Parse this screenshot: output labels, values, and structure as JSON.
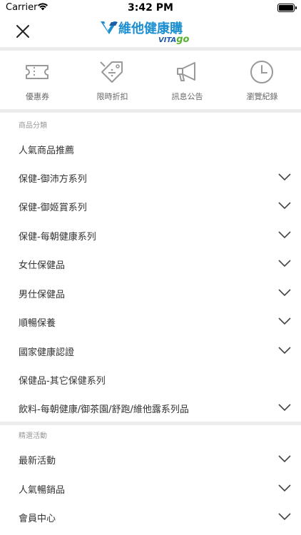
{
  "status_bar": {
    "carrier": "Carrier",
    "time": "3:42 PM"
  },
  "header": {
    "logo_text": "維他健康購",
    "logo_sub_left": "VITA",
    "logo_sub_right": "go",
    "brand_color": "#1c8fd0",
    "accent_color": "#57b22e"
  },
  "quick_links": [
    {
      "label": "優惠券",
      "icon": "ticket-icon"
    },
    {
      "label": "限時折扣",
      "icon": "discount-tag-icon"
    },
    {
      "label": "訊息公告",
      "icon": "megaphone-icon"
    },
    {
      "label": "瀏覽紀錄",
      "icon": "clock-icon"
    }
  ],
  "categories": {
    "title": "商品分類",
    "items": [
      {
        "label": "人氣商品推薦",
        "has_children": false
      },
      {
        "label": "保健-御沛方系列",
        "has_children": true
      },
      {
        "label": "保健-御姬賞系列",
        "has_children": true
      },
      {
        "label": "保健-每朝健康系列",
        "has_children": true
      },
      {
        "label": "女仕保健品",
        "has_children": true
      },
      {
        "label": "男仕保健品",
        "has_children": true
      },
      {
        "label": "順暢保養",
        "has_children": true
      },
      {
        "label": "國家健康認證",
        "has_children": true
      },
      {
        "label": "保健品-其它保健系列",
        "has_children": false
      },
      {
        "label": "飲料-每朝健康/御茶園/舒跑/維他露系列品",
        "has_children": true
      }
    ]
  },
  "events": {
    "title": "精選活動",
    "items": [
      {
        "label": "最新活動",
        "has_children": true
      },
      {
        "label": "人氣暢銷品",
        "has_children": true
      },
      {
        "label": "會員中心",
        "has_children": true
      }
    ]
  }
}
